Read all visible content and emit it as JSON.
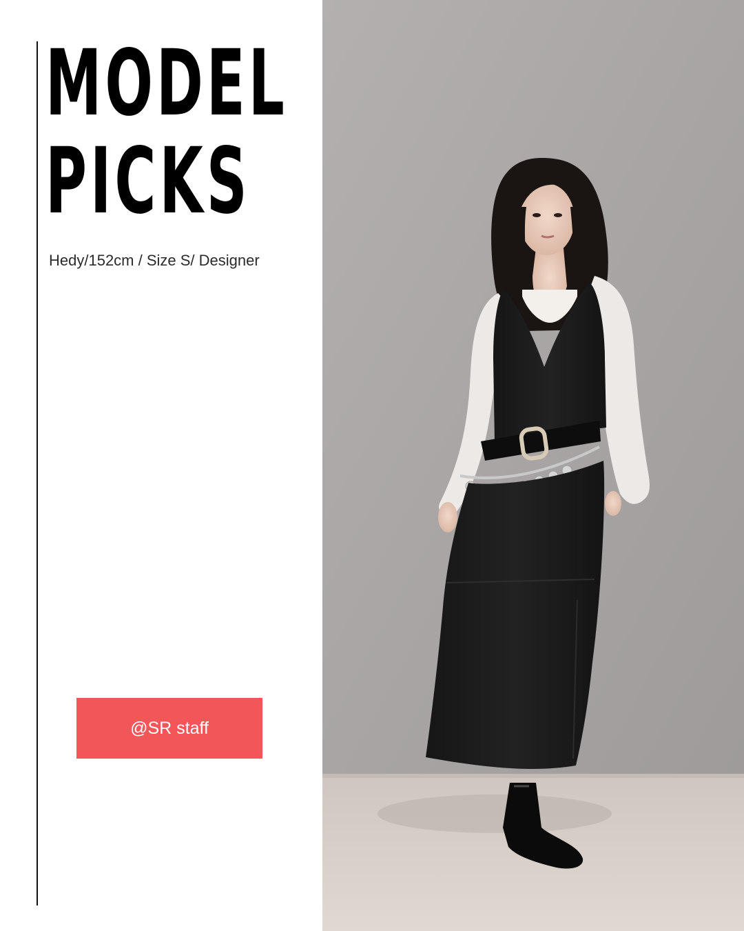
{
  "title": {
    "line1": "MODEL",
    "line2": "PICKS"
  },
  "subtitle": "Hedy/152cm / Size S/ Designer",
  "badge": {
    "label": "@SR staff"
  },
  "colors": {
    "accent": "#f25658",
    "wall": "#a9a6a5",
    "floor": "#d7d0c8"
  },
  "photo": {
    "icon": "model-photo"
  }
}
